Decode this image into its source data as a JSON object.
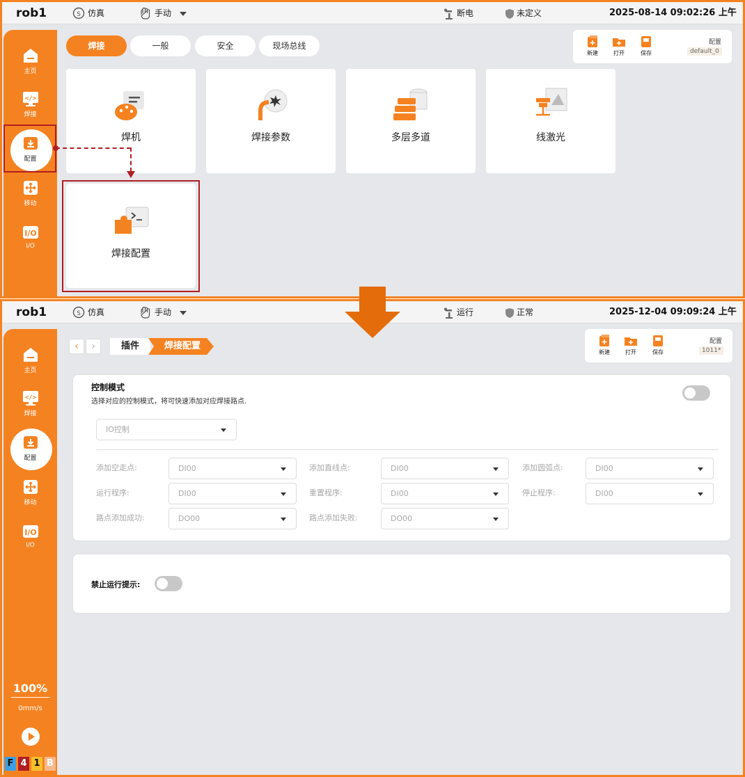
{
  "top": {
    "robot": "rob1",
    "mode": "仿真",
    "control": "手动",
    "power_status": "断电",
    "safety_status": "未定义",
    "datetime": "2025-08-14 09:02:26 上午"
  },
  "bottom": {
    "robot": "rob1",
    "mode": "仿真",
    "control": "手动",
    "run_status": "运行",
    "safety_status": "正常",
    "datetime": "2025-12-04 09:09:24 上午"
  },
  "nav": [
    {
      "label": "主页",
      "icon": "home-icon"
    },
    {
      "label": "焊接",
      "icon": "code-icon"
    },
    {
      "label": "配置",
      "icon": "config-icon"
    },
    {
      "label": "移动",
      "icon": "move-icon"
    },
    {
      "label": "I/O",
      "icon": "io-icon"
    }
  ],
  "tabs": [
    "焊接",
    "一般",
    "安全",
    "现场总线"
  ],
  "config_panel": {
    "title": "配置",
    "new": "新建",
    "open": "打开",
    "save": "保存",
    "name_top": "default_0",
    "name_bottom": "1011*"
  },
  "cards": [
    "焊机",
    "焊接参数",
    "多层多道",
    "线激光",
    "焊接配置"
  ],
  "breadcrumb": {
    "parent": "插件",
    "current": "焊接配置"
  },
  "control_mode": {
    "title": "控制模式",
    "desc": "选择对应的控制模式，将可快速添加对应焊接路点.",
    "mode_select": "IO控制",
    "fields": [
      {
        "label": "添加空走点:",
        "value": "DI00"
      },
      {
        "label": "添加直线点:",
        "value": "DI00"
      },
      {
        "label": "添加圆弧点:",
        "value": "DI00"
      },
      {
        "label": "运行程序:",
        "value": "DI00"
      },
      {
        "label": "重置程序:",
        "value": "DI00"
      },
      {
        "label": "停止程序:",
        "value": "DI00"
      },
      {
        "label": "路点添加成功:",
        "value": "DO00"
      },
      {
        "label": "路点添加失败:",
        "value": "DO00"
      }
    ]
  },
  "disable_run_prompt": {
    "label": "禁止运行提示:"
  },
  "speed": {
    "percent": "100%",
    "value": "0mm/s"
  },
  "indicators": [
    "F",
    "4",
    "1",
    "B"
  ],
  "colors": {
    "accent": "#f58220",
    "highlight": "#b01e23"
  }
}
